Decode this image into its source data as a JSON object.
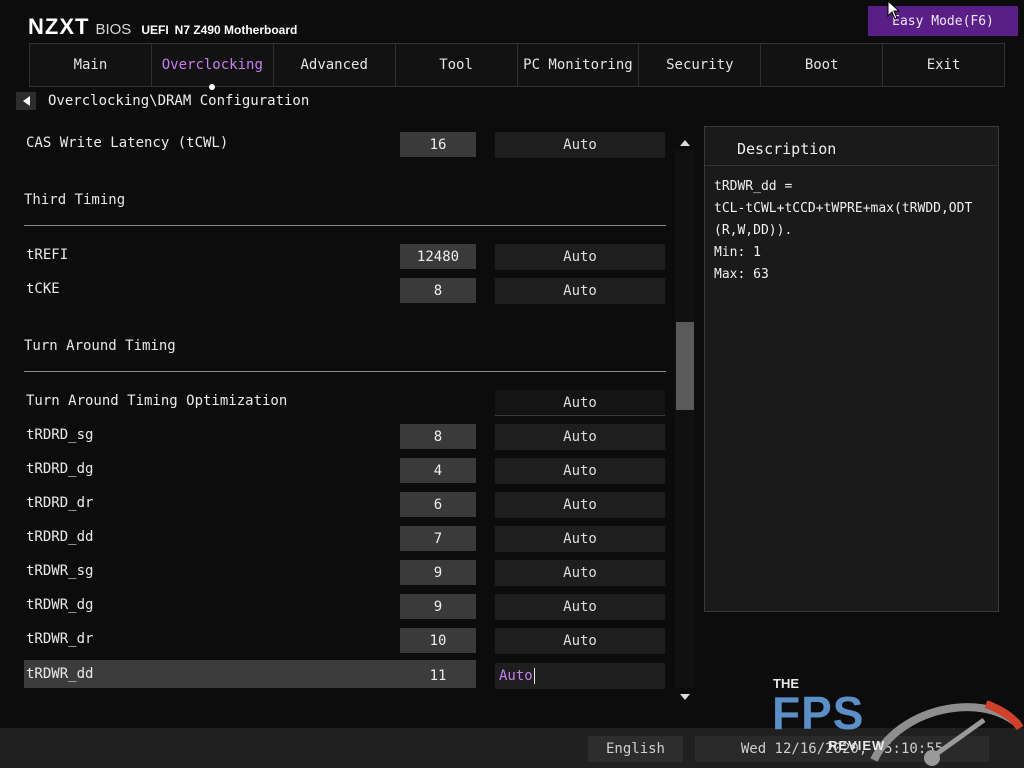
{
  "brand": {
    "name": "NZXT",
    "suffix": "BIOS",
    "uefi": "UEFI",
    "model": "N7 Z490 Motherboard"
  },
  "easy_mode": {
    "label": "Easy Mode(F6)"
  },
  "tabs": [
    {
      "label": "Main"
    },
    {
      "label": "Overclocking",
      "active": true
    },
    {
      "label": "Advanced"
    },
    {
      "label": "Tool"
    },
    {
      "label": "PC Monitoring"
    },
    {
      "label": "Security"
    },
    {
      "label": "Boot"
    },
    {
      "label": "Exit"
    }
  ],
  "breadcrumb": "Overclocking\\DRAM Configuration",
  "settings": {
    "cas_write": {
      "label": "CAS Write Latency (tCWL)",
      "value": "16",
      "mode": "Auto"
    },
    "third_timing": {
      "title": "Third Timing"
    },
    "trefi": {
      "label": "tREFI",
      "value": "12480",
      "mode": "Auto"
    },
    "tcke": {
      "label": "tCKE",
      "value": "8",
      "mode": "Auto"
    },
    "turn_around": {
      "title": "Turn Around Timing"
    },
    "tat_opt": {
      "label": "Turn Around Timing Optimization",
      "mode": "Auto"
    },
    "rows": [
      {
        "label": "tRDRD_sg",
        "value": "8",
        "mode": "Auto"
      },
      {
        "label": "tRDRD_dg",
        "value": "4",
        "mode": "Auto"
      },
      {
        "label": "tRDRD_dr",
        "value": "6",
        "mode": "Auto"
      },
      {
        "label": "tRDRD_dd",
        "value": "7",
        "mode": "Auto"
      },
      {
        "label": "tRDWR_sg",
        "value": "9",
        "mode": "Auto"
      },
      {
        "label": "tRDWR_dg",
        "value": "9",
        "mode": "Auto"
      },
      {
        "label": "tRDWR_dr",
        "value": "10",
        "mode": "Auto"
      },
      {
        "label": "tRDWR_dd",
        "value": "11",
        "mode": "Auto",
        "selected": true
      }
    ]
  },
  "description": {
    "title": "Description",
    "body": "tRDWR_dd =\ntCL-tCWL+tCCD+tWPRE+max(tRWDD,ODT\n(R,W,DD)).\nMin: 1\nMax: 63"
  },
  "footer": {
    "language": "English",
    "datetime": "Wed 12/16/2020, 05:10:55"
  },
  "watermark": {
    "the": "THE",
    "fps": "FPS",
    "review": "REVIEW"
  },
  "colors": {
    "accent": "#c77df0",
    "easy_mode_bg": "#5a1f86",
    "logo_blue": "#5b8fc7",
    "gauge_red": "#d0402a"
  },
  "icons": {
    "back": "chevron-left-icon",
    "scroll_up": "triangle-up-icon",
    "scroll_down": "triangle-down-icon",
    "cursor": "mouse-pointer-icon"
  }
}
